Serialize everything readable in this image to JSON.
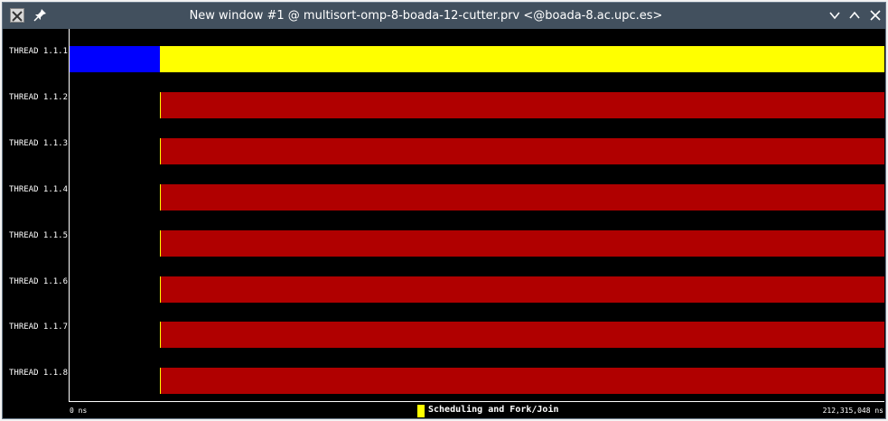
{
  "window": {
    "title": "New window #1 @ multisort-omp-8-boada-12-cutter.prv <@boada-8.ac.upc.es>"
  },
  "icons": {
    "app": "x-app-icon",
    "pin": "pin-icon",
    "minimize": "chevron-down-icon",
    "maximize": "chevron-up-icon",
    "close": "close-icon"
  },
  "colors": {
    "running": "#0000ff",
    "scheduling_fork_join": "#ffff00",
    "idle_state": "#b00000",
    "background": "#000000"
  },
  "chart_data": {
    "type": "timeline",
    "x_range_ns": [
      0,
      212315048
    ],
    "x_start_label": "0 ns",
    "x_end_label": "212,315,048 ns",
    "legend": {
      "label": "Scheduling and Fork/Join",
      "color": "#ffff00"
    },
    "rows": [
      {
        "label": "THREAD 1.1.1",
        "segments": [
          {
            "start": 0,
            "end": 23600000,
            "color": "#0000ff"
          },
          {
            "start": 23600000,
            "end": 212315048,
            "color": "#ffff00"
          }
        ]
      },
      {
        "label": "THREAD 1.1.2",
        "segments": [
          {
            "start": 23600000,
            "end": 23800000,
            "color": "#ffff00"
          },
          {
            "start": 23800000,
            "end": 212315048,
            "color": "#b00000"
          }
        ]
      },
      {
        "label": "THREAD 1.1.3",
        "segments": [
          {
            "start": 23600000,
            "end": 23800000,
            "color": "#ffff00"
          },
          {
            "start": 23800000,
            "end": 212315048,
            "color": "#b00000"
          }
        ]
      },
      {
        "label": "THREAD 1.1.4",
        "segments": [
          {
            "start": 23600000,
            "end": 23800000,
            "color": "#ffff00"
          },
          {
            "start": 23800000,
            "end": 212315048,
            "color": "#b00000"
          }
        ]
      },
      {
        "label": "THREAD 1.1.5",
        "segments": [
          {
            "start": 23600000,
            "end": 23800000,
            "color": "#ffff00"
          },
          {
            "start": 23800000,
            "end": 212315048,
            "color": "#b00000"
          }
        ]
      },
      {
        "label": "THREAD 1.1.6",
        "segments": [
          {
            "start": 23600000,
            "end": 23800000,
            "color": "#ffff00"
          },
          {
            "start": 23800000,
            "end": 212315048,
            "color": "#b00000"
          }
        ]
      },
      {
        "label": "THREAD 1.1.7",
        "segments": [
          {
            "start": 23600000,
            "end": 23800000,
            "color": "#ffff00"
          },
          {
            "start": 23800000,
            "end": 212315048,
            "color": "#b00000"
          }
        ]
      },
      {
        "label": "THREAD 1.1.8",
        "segments": [
          {
            "start": 23600000,
            "end": 23800000,
            "color": "#ffff00"
          },
          {
            "start": 23800000,
            "end": 212315048,
            "color": "#b00000"
          }
        ]
      }
    ]
  }
}
